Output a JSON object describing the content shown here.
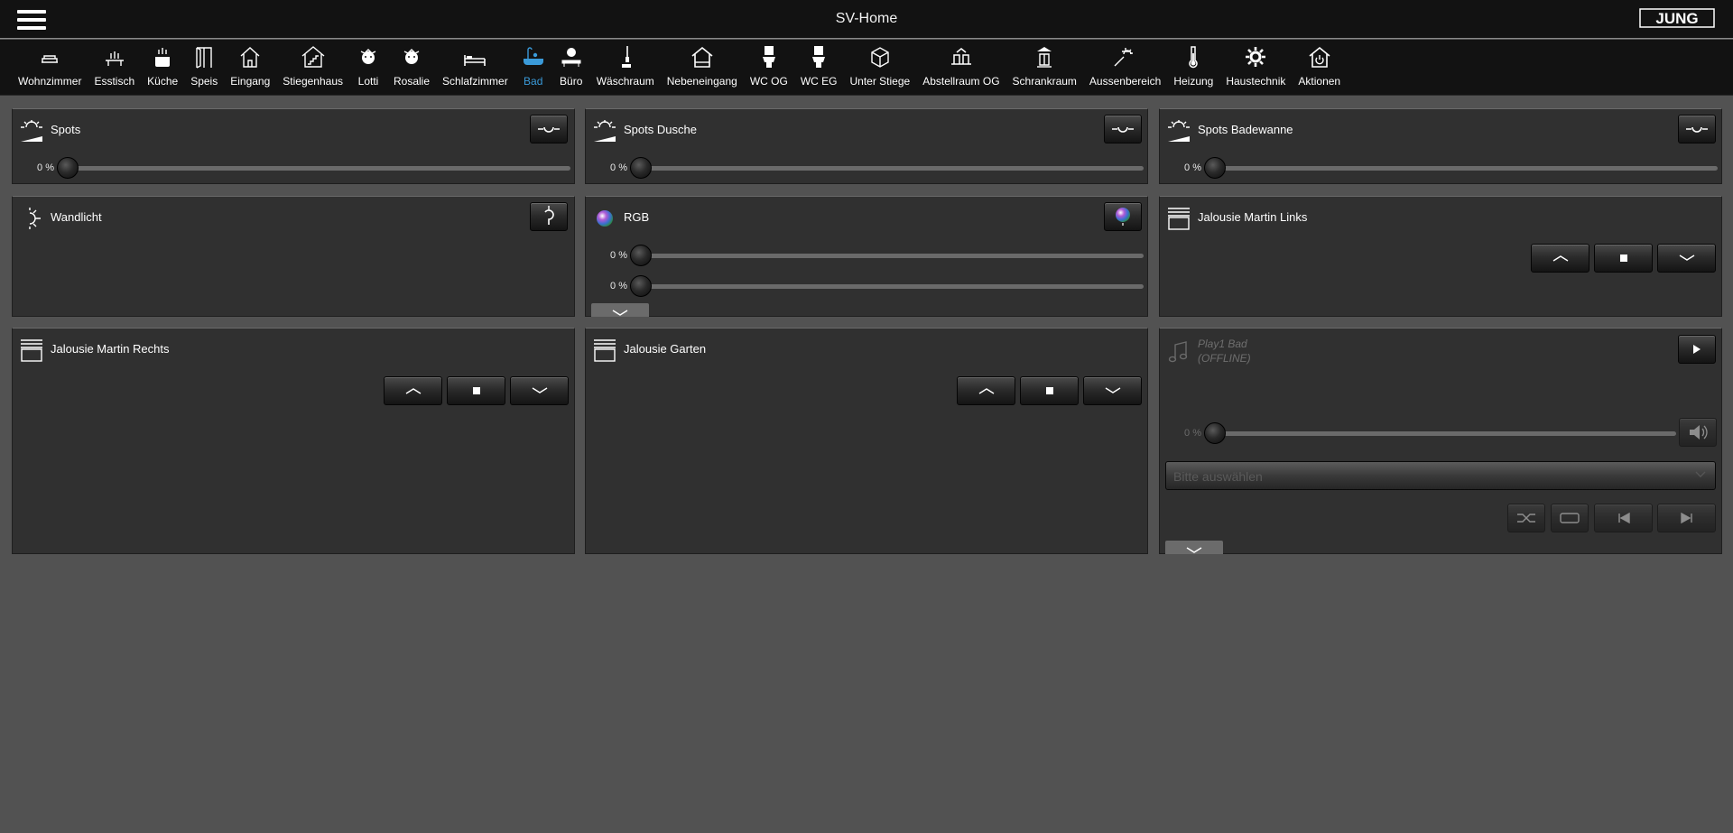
{
  "app": {
    "title": "SV-Home",
    "logo_text": "JUNG"
  },
  "rooms": [
    {
      "label": "Wohnzimmer",
      "icon": "sofa-icon"
    },
    {
      "label": "Esstisch",
      "icon": "dining-table-icon"
    },
    {
      "label": "Küche",
      "icon": "cooking-pot-icon"
    },
    {
      "label": "Speis",
      "icon": "pantry-door-icon"
    },
    {
      "label": "Eingang",
      "icon": "house-entrance-icon"
    },
    {
      "label": "Stiegenhaus",
      "icon": "staircase-house-icon"
    },
    {
      "label": "Lotti",
      "icon": "child-face-icon"
    },
    {
      "label": "Rosalie",
      "icon": "child-face-icon"
    },
    {
      "label": "Schlafzimmer",
      "icon": "bed-icon"
    },
    {
      "label": "Bad",
      "icon": "bathtub-icon",
      "active": true
    },
    {
      "label": "Büro",
      "icon": "office-desk-icon"
    },
    {
      "label": "Wäschraum",
      "icon": "vacuum-cleaner-icon"
    },
    {
      "label": "Nebeneingang",
      "icon": "house-outline-icon"
    },
    {
      "label": "WC OG",
      "icon": "toilet-icon"
    },
    {
      "label": "WC EG",
      "icon": "toilet-icon"
    },
    {
      "label": "Unter Stiege",
      "icon": "box-icon"
    },
    {
      "label": "Abstellraum OG",
      "icon": "storage-room-icon"
    },
    {
      "label": "Schrankraum",
      "icon": "wardrobe-icon"
    },
    {
      "label": "Aussenbereich",
      "icon": "garden-light-icon"
    },
    {
      "label": "Heizung",
      "icon": "thermometer-icon"
    },
    {
      "label": "Haustechnik",
      "icon": "gear-icon"
    },
    {
      "label": "Aktionen",
      "icon": "house-power-icon"
    }
  ],
  "widgets": {
    "spots": {
      "title": "Spots",
      "level": "0 %",
      "value_pct": 0
    },
    "spots_dusche": {
      "title": "Spots Dusche",
      "level": "0 %",
      "value_pct": 0
    },
    "spots_badewanne": {
      "title": "Spots Badewanne",
      "level": "0 %",
      "value_pct": 0
    },
    "wandlicht": {
      "title": "Wandlicht"
    },
    "rgb": {
      "title": "RGB",
      "level1": "0 %",
      "level2": "0 %",
      "value1_pct": 0,
      "value2_pct": 0
    },
    "jalousie_links": {
      "title": "Jalousie Martin Links"
    },
    "jalousie_rechts": {
      "title": "Jalousie Martin Rechts"
    },
    "jalousie_garten": {
      "title": "Jalousie Garten"
    },
    "player": {
      "title": "Play1 Bad",
      "status": "(OFFLINE)",
      "volume": "0 %",
      "volume_pct": 0,
      "select_placeholder": "Bitte auswählen"
    }
  },
  "colors": {
    "accent": "#3a9ad9",
    "panel": "#303030",
    "background": "#525252",
    "topbar": "#121212"
  }
}
